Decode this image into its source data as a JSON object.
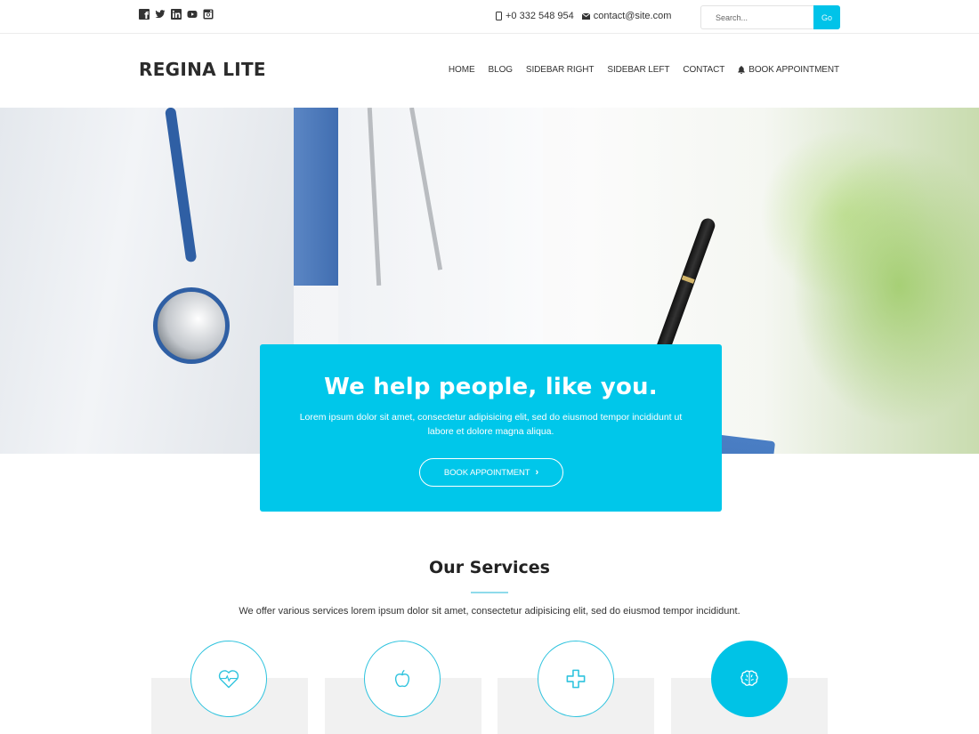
{
  "topbar": {
    "social": [
      {
        "name": "facebook-icon"
      },
      {
        "name": "twitter-icon"
      },
      {
        "name": "linkedin-icon"
      },
      {
        "name": "youtube-icon"
      },
      {
        "name": "instagram-icon"
      }
    ],
    "phone": "+0 332 548 954",
    "email": "contact@site.com",
    "search": {
      "placeholder": "Search...",
      "value": "",
      "button_label": "Go"
    }
  },
  "header": {
    "logo": "REGINA LITE",
    "nav": [
      {
        "label": "HOME"
      },
      {
        "label": "BLOG"
      },
      {
        "label": "SIDEBAR RIGHT"
      },
      {
        "label": "SIDEBAR LEFT"
      },
      {
        "label": "CONTACT"
      },
      {
        "label": "BOOK APPOINTMENT",
        "icon": "bell-icon"
      }
    ]
  },
  "hero": {
    "title": "We help people, like you.",
    "text": "Lorem ipsum dolor sit amet, consectetur adipisicing elit, sed do eiusmod tempor incididunt ut labore et dolore magna aliqua.",
    "button_label": "BOOK APPOINTMENT",
    "button_icon": "chevron-right-icon"
  },
  "services": {
    "title": "Our Services",
    "subtitle": "We offer various services lorem ipsum dolor sit amet, consectetur adipisicing elit, sed do eiusmod tempor incididunt.",
    "items": [
      {
        "icon": "heart-pulse-icon"
      },
      {
        "icon": "apple-icon"
      },
      {
        "icon": "medical-cross-icon"
      },
      {
        "icon": "brain-icon"
      }
    ]
  },
  "colors": {
    "accent": "#00c7ea",
    "text": "#333333",
    "card_bg": "#f1f1f1"
  }
}
